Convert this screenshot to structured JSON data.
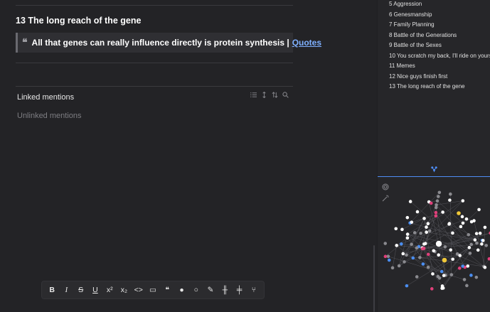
{
  "editor": {
    "heading": "13 The long reach of the gene",
    "quote_text": "All that genes can really influence directly is protein synthesis |",
    "quote_link": "Quotes",
    "linked_mentions": "Linked mentions",
    "unlinked_mentions": "Unlinked mentions",
    "mention_tool_icons": [
      "list-icon",
      "expand-icon",
      "sort-icon",
      "search-icon"
    ]
  },
  "toolbar": {
    "items": [
      {
        "name": "bold-button",
        "glyph": "B"
      },
      {
        "name": "italic-button",
        "glyph": "I"
      },
      {
        "name": "strikethrough-button",
        "glyph": "S"
      },
      {
        "name": "underline-button",
        "glyph": "U"
      },
      {
        "name": "superscript-button",
        "glyph": "x²"
      },
      {
        "name": "subscript-button",
        "glyph": "x₂"
      },
      {
        "name": "code-button",
        "glyph": "<>"
      },
      {
        "name": "codeblock-button",
        "glyph": "▭"
      },
      {
        "name": "quote-button",
        "glyph": "❝"
      },
      {
        "name": "idea-filled-button",
        "glyph": "●"
      },
      {
        "name": "idea-outline-button",
        "glyph": "○"
      },
      {
        "name": "highlight-button",
        "glyph": "✎"
      },
      {
        "name": "split-vertical-button",
        "glyph": "╫"
      },
      {
        "name": "split-horizontal-button",
        "glyph": "╪"
      },
      {
        "name": "graph-link-button",
        "glyph": "⑂"
      }
    ]
  },
  "sidebar": {
    "chapters": [
      "5 Aggression",
      "6 Genesmanship",
      "7 Family Planning",
      "8 Battle of the Generations",
      "9 Battle of the Sexes",
      "10 You scratch my back, I'll ride on yours",
      "11 Memes",
      "12 Nice guys finish first",
      "13 The long reach of the gene"
    ],
    "graph_tab_icon": "graph-icon",
    "graph_tools": [
      "settings-icon",
      "wand-icon"
    ]
  },
  "colors": {
    "accent": "#4f8df5",
    "node_white": "#ffffff",
    "node_gray": "#8a8a8f",
    "node_blue": "#4a8df0",
    "node_pink": "#e0407a",
    "node_yellow": "#f0c838"
  }
}
